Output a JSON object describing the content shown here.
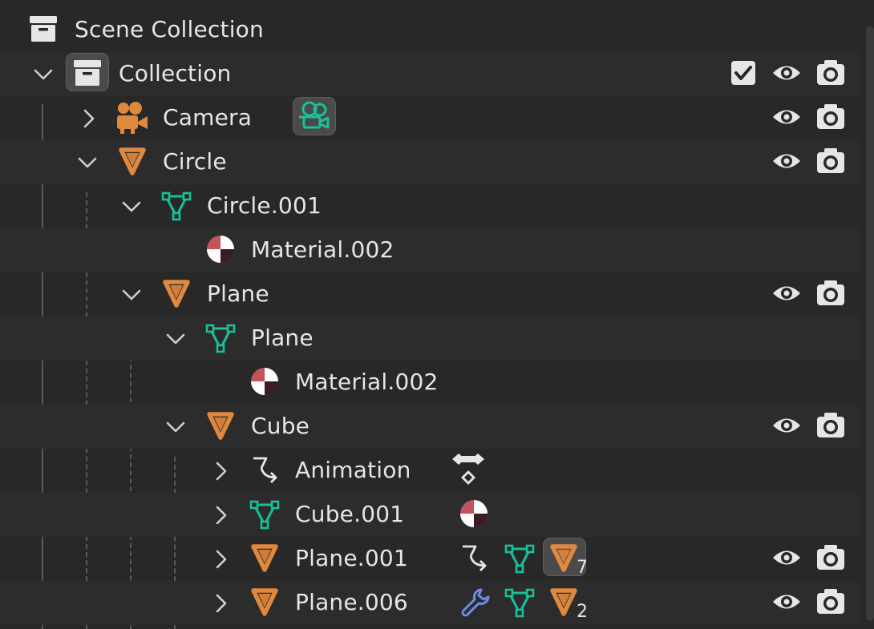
{
  "outliner": {
    "rows": [
      {
        "label": "Scene Collection",
        "type": "scene-collection"
      },
      {
        "label": "Collection",
        "type": "collection",
        "expanded": true,
        "checkbox": true,
        "visible": true,
        "renderable": true
      },
      {
        "label": "Camera",
        "type": "camera-object",
        "expanded": false,
        "visible": true,
        "renderable": true
      },
      {
        "label": "Circle",
        "type": "mesh-object",
        "expanded": true,
        "visible": true,
        "renderable": true
      },
      {
        "label": "Circle.001",
        "type": "mesh-data",
        "expanded": true
      },
      {
        "label": "Material.002",
        "type": "material"
      },
      {
        "label": "Plane",
        "type": "mesh-object",
        "expanded": true,
        "visible": true,
        "renderable": true
      },
      {
        "label": "Plane",
        "type": "mesh-data",
        "expanded": true
      },
      {
        "label": "Material.002",
        "type": "material"
      },
      {
        "label": "Cube",
        "type": "mesh-object",
        "expanded": true,
        "visible": true,
        "renderable": true
      },
      {
        "label": "Animation",
        "type": "animation",
        "expanded": false
      },
      {
        "label": "Cube.001",
        "type": "mesh-data",
        "expanded": false
      },
      {
        "label": "Plane.001",
        "type": "mesh-object",
        "expanded": false,
        "child_count": "7",
        "visible": true,
        "renderable": true
      },
      {
        "label": "Plane.006",
        "type": "mesh-object",
        "expanded": false,
        "child_count": "2",
        "visible": true,
        "renderable": true
      }
    ]
  },
  "colors": {
    "background": "#282828",
    "row_alt": "#2c2c2c",
    "text": "#e6e6e6",
    "object_orange": "#e0883e",
    "mesh_green": "#17c19a",
    "material_red": "#c4545c",
    "modifier_blue": "#6d8ee8",
    "icon_grey": "#e6e6e6"
  }
}
